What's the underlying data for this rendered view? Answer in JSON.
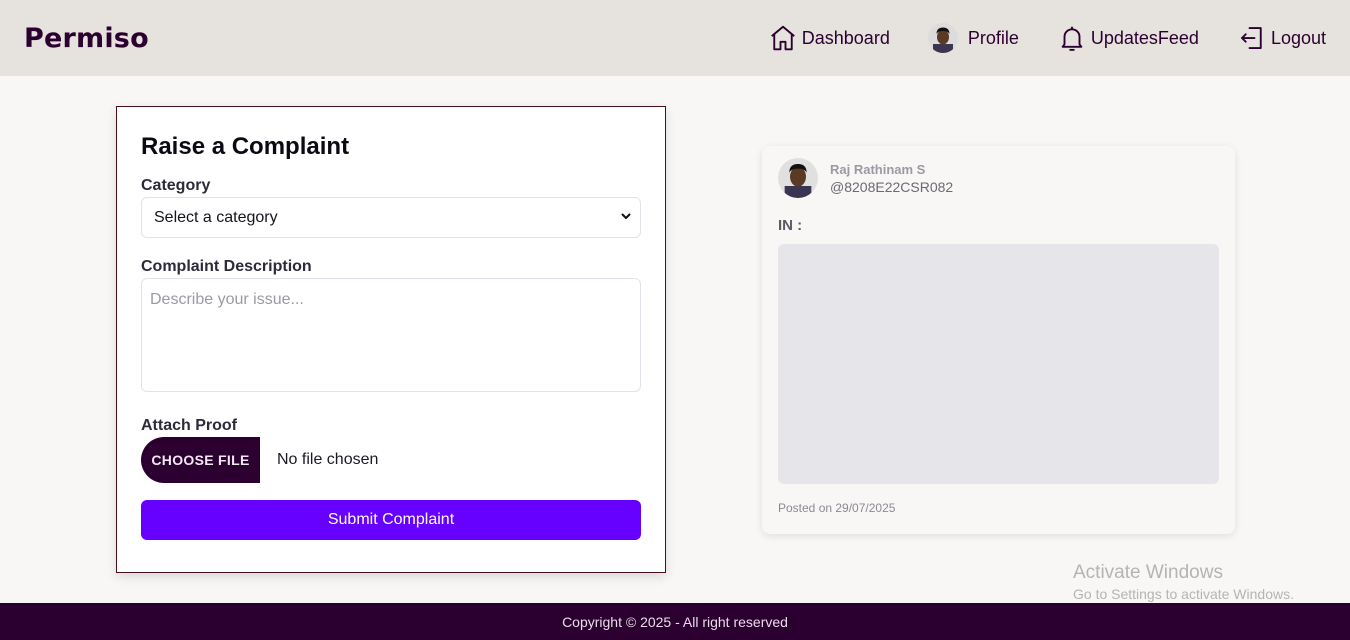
{
  "header": {
    "brand": "Permiso",
    "nav": {
      "dashboard": "Dashboard",
      "profile": "Profile",
      "updates_feed": "UpdatesFeed",
      "logout": "Logout"
    }
  },
  "form": {
    "title": "Raise a Complaint",
    "category_label": "Category",
    "category_selected": "Select a category",
    "description_label": "Complaint Description",
    "description_placeholder": "Describe your issue...",
    "attach_label": "Attach Proof",
    "choose_file_label": "CHOOSE FILE",
    "file_status": "No file chosen",
    "submit_label": "Submit Complaint"
  },
  "post": {
    "name": "Raj Rathinam S",
    "handle": "@8208E22CSR082",
    "type_label": "IN :",
    "posted_on": "Posted on 29/07/2025"
  },
  "watermark": {
    "title": "Activate Windows",
    "subtitle": "Go to Settings to activate Windows."
  },
  "footer": {
    "copyright": "Copyright © 2025 - All right reserved"
  },
  "colors": {
    "brand": "#2b0030",
    "header_bg": "#e6e2dd",
    "accent": "#6600ff",
    "footer_bg": "#2b0030"
  },
  "icons": [
    "home-icon",
    "profile-avatar",
    "bell-icon",
    "logout-icon",
    "chevron-down-icon"
  ]
}
